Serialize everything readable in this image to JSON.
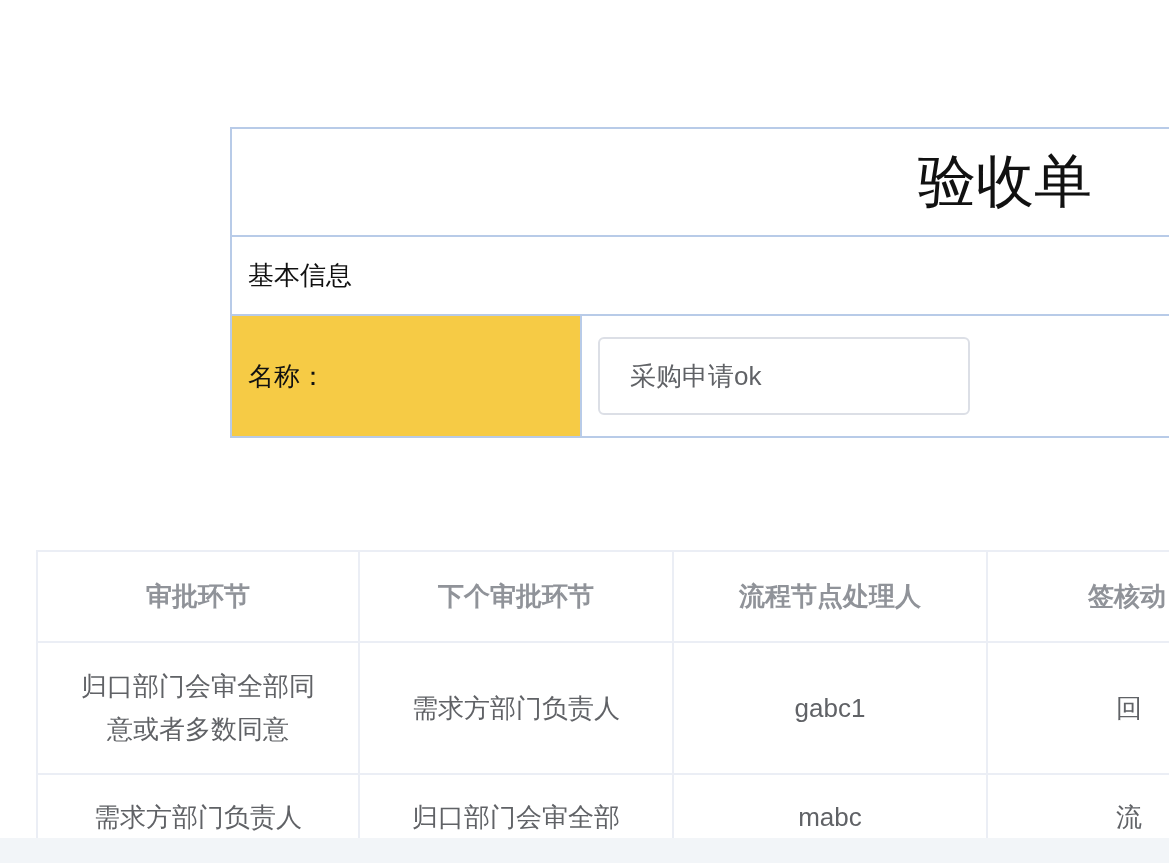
{
  "form": {
    "title": "验收单",
    "section": "基本信息",
    "fields": [
      {
        "label": "名称：",
        "value": "采购申请ok"
      }
    ]
  },
  "table": {
    "columns": [
      "审批环节",
      "下个审批环节",
      "流程节点处理人",
      "签核动"
    ],
    "rows": [
      [
        "归口部门会审全部同意或者多数同意",
        "需求方部门负责人",
        "gabc1",
        "回"
      ],
      [
        "需求方部门负责人",
        "归口部门会审全部",
        "mabc",
        "流"
      ]
    ]
  }
}
